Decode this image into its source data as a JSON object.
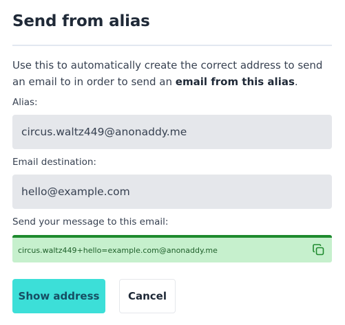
{
  "dialog": {
    "title": "Send from alias",
    "description_prefix": "Use this to automatically create the correct address to send an email to in order to send an ",
    "description_bold": "email from this alias",
    "description_suffix": ".",
    "alias_label": "Alias:",
    "alias_value": "circus.waltz449@anonaddy.me",
    "destination_label": "Email destination:",
    "destination_value": "hello@example.com",
    "result_label": "Send your message to this email:",
    "result_value": "circus.waltz449+hello=example.com@anonaddy.me",
    "show_address_label": "Show address",
    "cancel_label": "Cancel"
  },
  "colors": {
    "primary_button": "#3cdfd8",
    "result_background": "#c6f0cd",
    "result_border": "#1e8a2e",
    "input_background": "#e5e7eb"
  },
  "icons": {
    "copy": "copy-icon"
  }
}
